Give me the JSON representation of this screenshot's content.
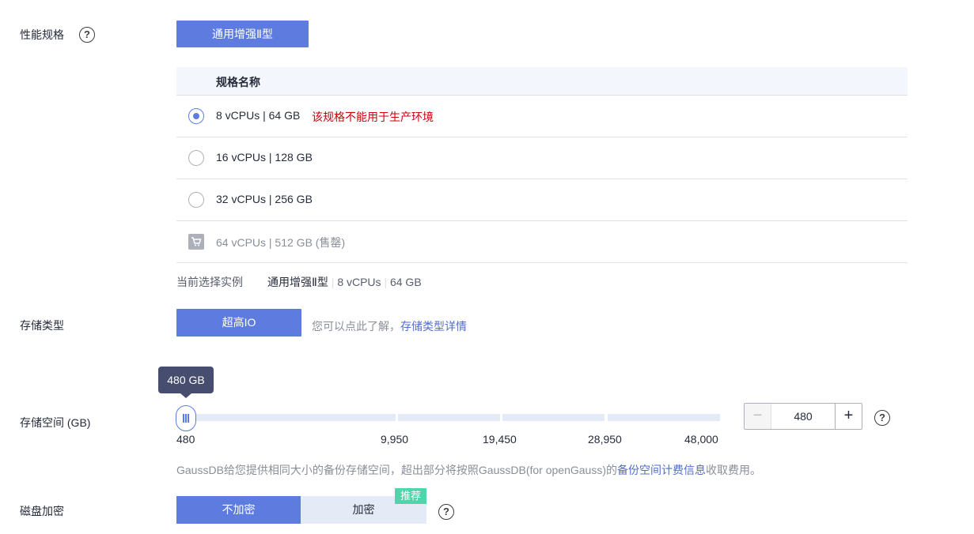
{
  "spec": {
    "label": "性能规格",
    "type_button": "通用增强Ⅱ型",
    "table_header": "规格名称",
    "rows": [
      {
        "text": "8 vCPUs | 64 GB",
        "warning": "该规格不能用于生产环境",
        "state": "checked"
      },
      {
        "text": "16 vCPUs | 128 GB",
        "state": "unchecked"
      },
      {
        "text": "32 vCPUs | 256 GB",
        "state": "unchecked"
      },
      {
        "text": "64 vCPUs | 512 GB (售罄)",
        "state": "sold-out"
      }
    ],
    "current_label": "当前选择实例",
    "current_type": "通用增强Ⅱ型",
    "current_cpu": "8 vCPUs",
    "current_mem": "64 GB"
  },
  "storage_type": {
    "label": "存储类型",
    "button": "超高IO",
    "hint": "您可以点此了解，",
    "link": "存储类型详情"
  },
  "storage_space": {
    "label": "存储空间 (GB)",
    "tooltip": "480 GB",
    "value": "480",
    "slider_value": 480,
    "ticks": [
      "480",
      "9,950",
      "19,450",
      "28,950",
      "48,000"
    ],
    "info_prefix": "GaussDB给您提供相同大小的备份存储空间，超出部分将按照GaussDB(for openGauss)的",
    "info_link": "备份空间计费信息",
    "info_suffix": "收取费用。"
  },
  "encryption": {
    "label": "磁盘加密",
    "off": "不加密",
    "on": "加密",
    "badge": "推荐"
  },
  "icons": {
    "help": "?",
    "minus": "−",
    "plus": "+",
    "cart": "🛒"
  },
  "colors": {
    "primary": "#5e7ce0",
    "warning": "#c7000b",
    "link": "#526ecc",
    "badge": "#50d4ab"
  }
}
